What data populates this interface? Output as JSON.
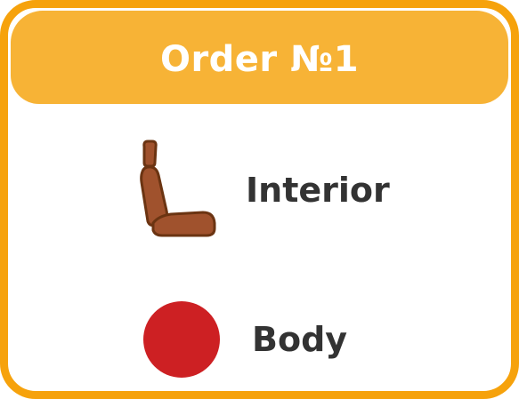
{
  "order": {
    "title": "Order №1"
  },
  "items": [
    {
      "label": "Interior",
      "icon": "car-seat-icon",
      "color": "#a0522d"
    },
    {
      "label": "Body",
      "icon": "color-swatch-icon",
      "color": "#cd2023"
    }
  ],
  "colors": {
    "frame": "#f6a20c",
    "header": "#f7b336",
    "text": "#333333"
  }
}
